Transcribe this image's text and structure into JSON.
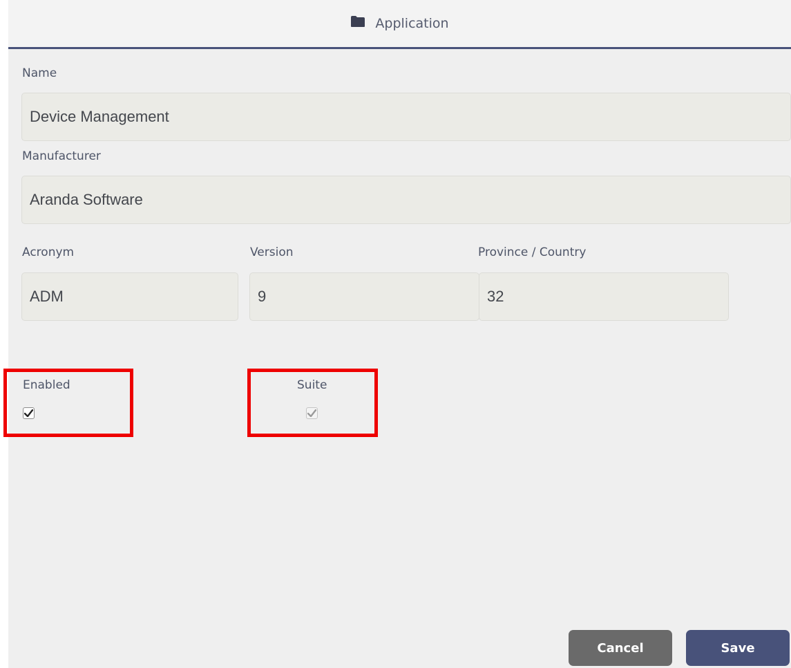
{
  "dialog": {
    "title": "Application",
    "title_icon": "folder-icon"
  },
  "form": {
    "name": {
      "label": "Name",
      "value": "Device Management"
    },
    "manufacturer": {
      "label": "Manufacturer",
      "value": "Aranda Software"
    },
    "acronym": {
      "label": "Acronym",
      "value": "ADM"
    },
    "version": {
      "label": "Version",
      "value": "9"
    },
    "province_country": {
      "label": "Province / Country",
      "value": "32"
    },
    "enabled": {
      "label": "Enabled",
      "checked": true,
      "disabled": false
    },
    "suite": {
      "label": "Suite",
      "checked": true,
      "disabled": true
    }
  },
  "actions": {
    "cancel_label": "Cancel",
    "save_label": "Save"
  },
  "colors": {
    "accent": "#48527a",
    "cancel": "#6a6a6a",
    "highlight": "#ee0000",
    "field_bg": "#ebebe6",
    "panel_bg": "#efefef"
  }
}
